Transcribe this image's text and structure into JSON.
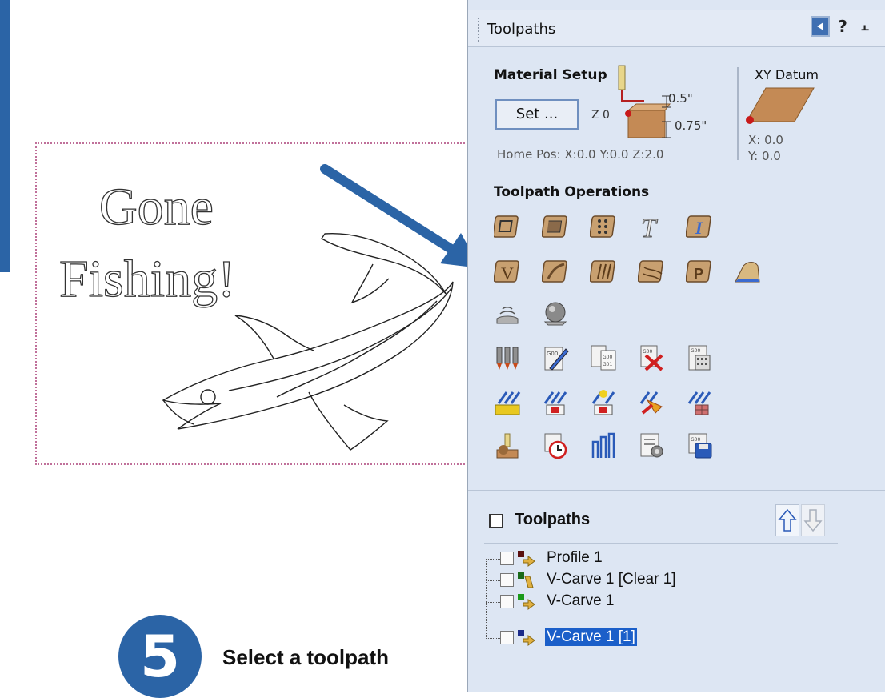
{
  "canvas": {
    "text_line1": "Gone",
    "text_line2": "Fishing!"
  },
  "callout": {
    "step_number": "5",
    "instruction": "Select a toolpath"
  },
  "panel": {
    "title": "Toolpaths",
    "header_buttons": {
      "help": "?",
      "pin": "⫠"
    },
    "material_setup": {
      "title": "Material Setup",
      "set_button": "Set ...",
      "z_label": "Z 0",
      "top_offset": "0.5\"",
      "thickness": "0.75\"",
      "home_pos": "Home Pos:  X:0.0 Y:0.0 Z:2.0"
    },
    "xy_datum": {
      "title": "XY Datum",
      "x": "X: 0.0",
      "y": "Y: 0.0"
    },
    "operations_title": "Toolpath Operations",
    "toolpaths_section": {
      "title": "Toolpaths",
      "items": [
        {
          "label": "Profile 1",
          "selected": false
        },
        {
          "label": "V-Carve 1 [Clear 1]",
          "selected": false
        },
        {
          "label": "V-Carve 1",
          "selected": false
        },
        {
          "label": "V-Carve 1 [1]",
          "selected": true
        }
      ]
    }
  },
  "colors": {
    "accent_blue": "#2b64a6",
    "panel_bg": "#dde6f3",
    "selection": "#1b5fc9",
    "material": "#c48a55"
  }
}
